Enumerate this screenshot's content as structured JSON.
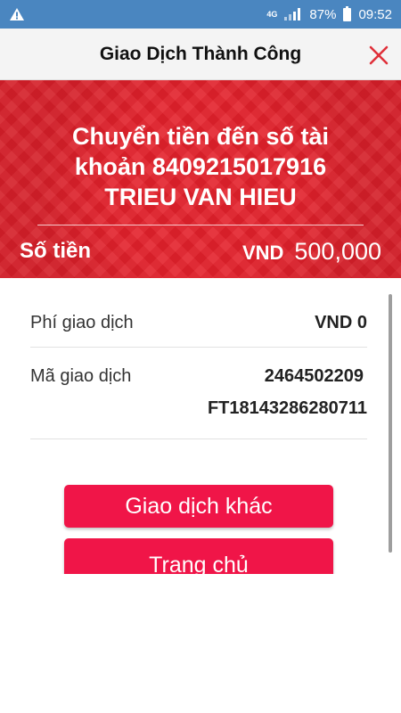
{
  "status_bar": {
    "network": "4G",
    "battery": "87%",
    "time": "09:52"
  },
  "header": {
    "title": "Giao Dịch Thành Công"
  },
  "banner": {
    "line1": "Chuyển tiền đến số tài",
    "line2": "khoản 8409215017916",
    "line3": "TRIEU VAN HIEU",
    "amount_label": "Số tiền",
    "amount_currency": "VND",
    "amount_value": "500,000"
  },
  "details": {
    "fee_label": "Phí giao dịch",
    "fee_value": "VND 0",
    "code_label": "Mã giao dịch",
    "code_line1": "2464502209",
    "code_line2": "FT18143286280711"
  },
  "buttons": {
    "other_transaction": "Giao dịch khác",
    "home": "Trang chủ"
  },
  "colors": {
    "status_bar": "#4a86c0",
    "banner_red": "#e4212b",
    "button_red": "#f01548",
    "close_icon": "#e0303a"
  }
}
